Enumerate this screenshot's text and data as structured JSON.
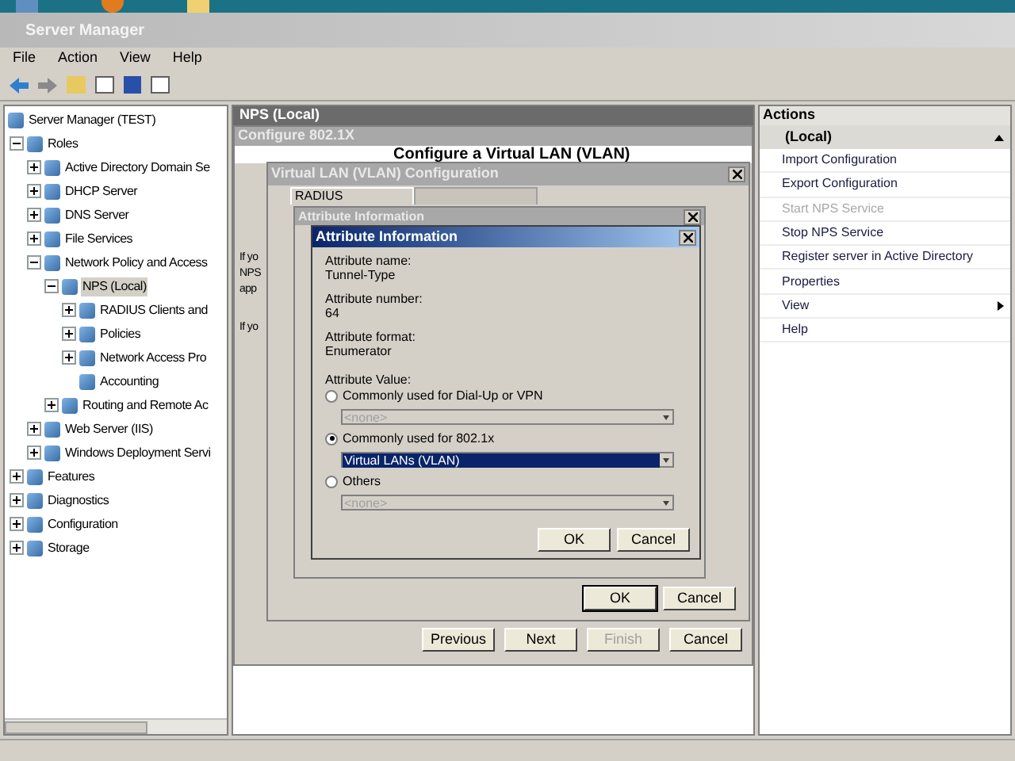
{
  "window": {
    "title": "Server Manager"
  },
  "menu": [
    "File",
    "Action",
    "View",
    "Help"
  ],
  "tree": [
    {
      "label": "Server Manager (TEST)",
      "selected": false,
      "children": [
        {
          "label": "Roles",
          "expanded": true,
          "selected": false,
          "children": [
            {
              "label": "Active Directory Domain Se",
              "expanded": false,
              "selected": false
            },
            {
              "label": "DHCP Server",
              "expanded": false,
              "selected": false
            },
            {
              "label": "DNS Server",
              "expanded": false,
              "selected": false
            },
            {
              "label": "File Services",
              "expanded": false,
              "selected": false
            },
            {
              "label": "Network Policy and Access",
              "expanded": true,
              "selected": false,
              "children": [
                {
                  "label": "NPS (Local)",
                  "expanded": true,
                  "selected": true,
                  "children": [
                    {
                      "label": "RADIUS Clients and",
                      "expanded": false,
                      "selected": false
                    },
                    {
                      "label": "Policies",
                      "expanded": false,
                      "selected": false
                    },
                    {
                      "label": "Network Access Pro",
                      "expanded": false,
                      "selected": false
                    },
                    {
                      "label": "Accounting",
                      "selected": false
                    }
                  ]
                },
                {
                  "label": "Routing and Remote Ac",
                  "expanded": false,
                  "selected": false
                }
              ]
            },
            {
              "label": "Web Server (IIS)",
              "expanded": false,
              "selected": false
            },
            {
              "label": "Windows Deployment Servi",
              "expanded": false,
              "selected": false
            }
          ]
        },
        {
          "label": "Features",
          "expanded": false,
          "selected": false
        },
        {
          "label": "Diagnostics",
          "expanded": false,
          "selected": false
        },
        {
          "label": "Configuration",
          "expanded": false,
          "selected": false
        },
        {
          "label": "Storage",
          "expanded": false,
          "selected": false
        }
      ]
    }
  ],
  "center": {
    "title": "NPS (Local)",
    "wizard_fragments": [
      "If yo",
      "NPS",
      "app",
      "If yo"
    ]
  },
  "wizard": {
    "title": "Configure 802.1X",
    "heading": "Configure a Virtual LAN (VLAN)",
    "buttons": [
      {
        "label": "Previous",
        "disabled": false
      },
      {
        "label": "Next",
        "disabled": false
      },
      {
        "label": "Finish",
        "disabled": true
      },
      {
        "label": "Cancel",
        "disabled": false
      }
    ]
  },
  "vlan_dialog": {
    "title": "Virtual LAN (VLAN) Configuration",
    "tabs": [
      {
        "label": "RADIUS",
        "selected": true
      },
      {
        "selected": false
      }
    ],
    "buttons": [
      "OK",
      "Cancel"
    ]
  },
  "attribute_dialog_back": {
    "title": "Attribute Information"
  },
  "attribute_dialog": {
    "title": "Attribute Information",
    "fields": [
      {
        "label": "Attribute name:",
        "value": "Tunnel-Type"
      },
      {
        "label": "Attribute number:",
        "value": "64"
      },
      {
        "label": "Attribute format:",
        "value": "Enumerator"
      }
    ],
    "value_label": "Attribute Value:",
    "options": [
      {
        "label": "Commonly used for Dial-Up or VPN",
        "selected": false,
        "value": "<none>"
      },
      {
        "label": "Commonly used for 802.1x",
        "selected": true,
        "value": "Virtual LANs (VLAN)"
      },
      {
        "label": "Others",
        "selected": false,
        "value": "<none>"
      }
    ],
    "buttons": [
      "OK",
      "Cancel"
    ]
  },
  "actions": {
    "title": "Actions",
    "section": "(Local)",
    "expanded": true,
    "items": [
      {
        "label": "Import Configuration",
        "disabled": false,
        "submenu": false
      },
      {
        "label": "Export Configuration",
        "disabled": false,
        "submenu": false
      },
      {
        "label": "Start NPS Service",
        "disabled": true,
        "submenu": false
      },
      {
        "label": "Stop NPS Service",
        "disabled": false,
        "submenu": false
      },
      {
        "label": "Register server in Active Directory",
        "disabled": false,
        "submenu": false
      },
      {
        "label": "Properties",
        "disabled": false,
        "submenu": false
      },
      {
        "label": "View",
        "disabled": false,
        "submenu": true
      },
      {
        "label": "Help",
        "disabled": false,
        "submenu": false
      }
    ]
  }
}
